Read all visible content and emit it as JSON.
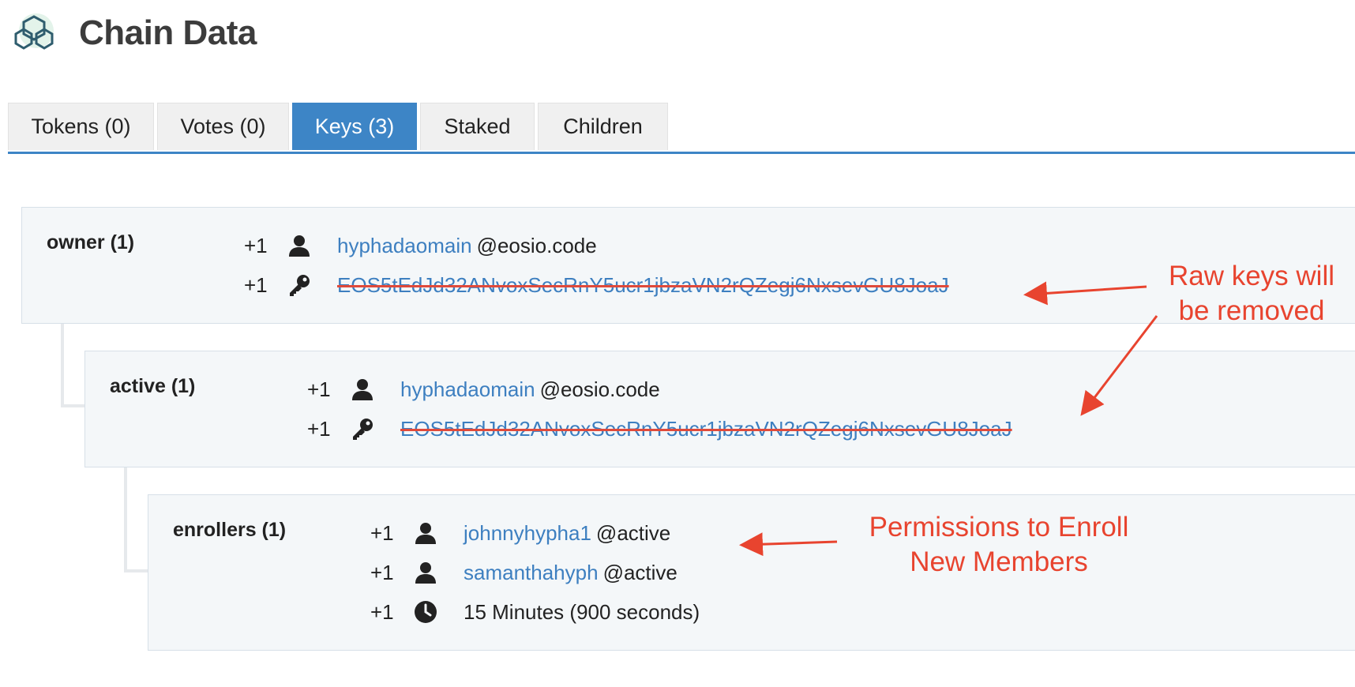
{
  "header": {
    "title": "Chain Data",
    "logo_icon": "hexagon-network-icon"
  },
  "tabs": [
    {
      "label": "Tokens (0)",
      "active": false
    },
    {
      "label": "Votes (0)",
      "active": false
    },
    {
      "label": "Keys (3)",
      "active": true
    },
    {
      "label": "Staked",
      "active": false
    },
    {
      "label": "Children",
      "active": false
    }
  ],
  "permissions": {
    "owner": {
      "name": "owner (1)",
      "rows": [
        {
          "weight": "+1",
          "icon": "user-icon",
          "account": "hyphadaomain",
          "permission": "@eosio.code"
        },
        {
          "weight": "+1",
          "icon": "key-icon",
          "key": "EOS5tEdJd32ANvoxSecRnY5ucr1jbzaVN2rQZegj6NxsevGU8JoaJ"
        }
      ]
    },
    "active": {
      "name": "active (1)",
      "rows": [
        {
          "weight": "+1",
          "icon": "user-icon",
          "account": "hyphadaomain",
          "permission": "@eosio.code"
        },
        {
          "weight": "+1",
          "icon": "key-icon",
          "key": "EOS5tEdJd32ANvoxSecRnY5ucr1jbzaVN2rQZegj6NxsevGU8JoaJ"
        }
      ]
    },
    "enrollers": {
      "name": "enrollers (1)",
      "rows": [
        {
          "weight": "+1",
          "icon": "user-icon",
          "account": "johnnyhypha1",
          "permission": "@active"
        },
        {
          "weight": "+1",
          "icon": "user-icon",
          "account": "samanthahyph",
          "permission": "@active"
        },
        {
          "weight": "+1",
          "icon": "clock-icon",
          "text": "15 Minutes (900 seconds)"
        }
      ]
    }
  },
  "annotations": {
    "raw_keys_line1": "Raw keys will",
    "raw_keys_line2": "be removed",
    "enroll_line1": "Permissions to Enroll",
    "enroll_line2": "New Members",
    "color": "#e8442f"
  },
  "colors": {
    "accent": "#3d85c6",
    "link": "#3d7fc0",
    "panel_bg": "#f4f7f9"
  }
}
